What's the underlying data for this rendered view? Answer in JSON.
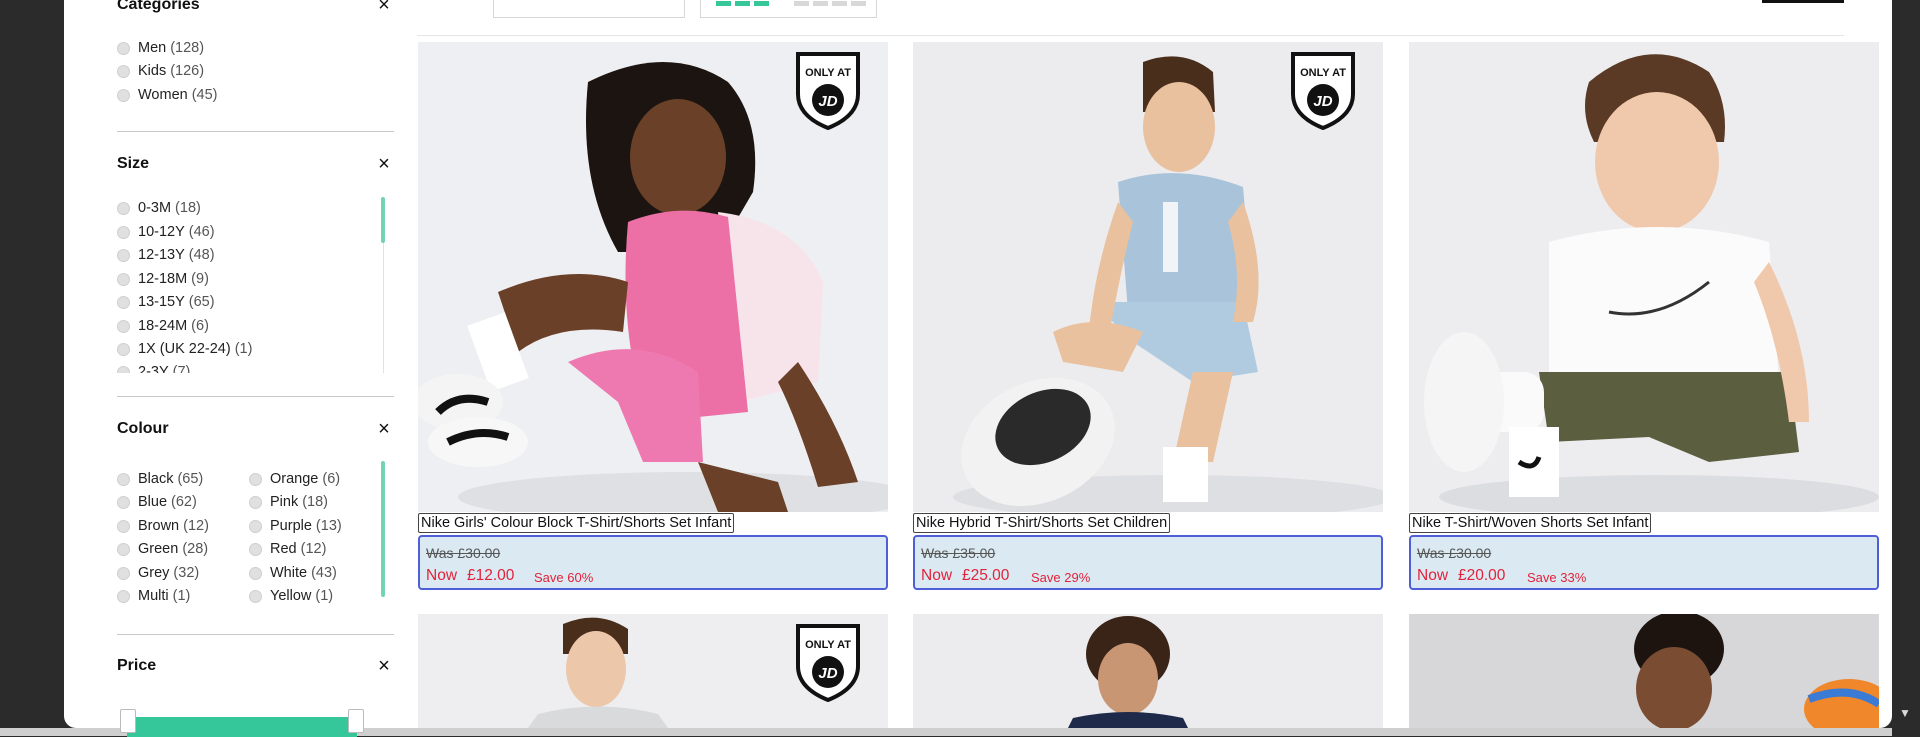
{
  "filters": {
    "categories": {
      "title": "Categories",
      "options": [
        {
          "label": "Men",
          "count": "(128)"
        },
        {
          "label": "Kids",
          "count": "(126)"
        },
        {
          "label": "Women",
          "count": "(45)"
        }
      ]
    },
    "size": {
      "title": "Size",
      "options": [
        {
          "label": "0-3M",
          "count": "(18)"
        },
        {
          "label": "10-12Y",
          "count": "(46)"
        },
        {
          "label": "12-13Y",
          "count": "(48)"
        },
        {
          "label": "12-18M",
          "count": "(9)"
        },
        {
          "label": "13-15Y",
          "count": "(65)"
        },
        {
          "label": "18-24M",
          "count": "(6)"
        },
        {
          "label": "1X (UK 22-24)",
          "count": "(1)"
        },
        {
          "label": "2-3Y",
          "count": "(7)"
        }
      ]
    },
    "colour": {
      "title": "Colour",
      "options": [
        {
          "label": "Black",
          "count": "(65)"
        },
        {
          "label": "Blue",
          "count": "(62)"
        },
        {
          "label": "Brown",
          "count": "(12)"
        },
        {
          "label": "Green",
          "count": "(28)"
        },
        {
          "label": "Grey",
          "count": "(32)"
        },
        {
          "label": "Multi",
          "count": "(1)"
        },
        {
          "label": "Orange",
          "count": "(6)"
        },
        {
          "label": "Pink",
          "count": "(18)"
        },
        {
          "label": "Purple",
          "count": "(13)"
        },
        {
          "label": "Red",
          "count": "(12)"
        },
        {
          "label": "White",
          "count": "(43)"
        },
        {
          "label": "Yellow",
          "count": "(1)"
        }
      ]
    },
    "price": {
      "title": "Price"
    }
  },
  "products": [
    {
      "name": "Nike Girls' Colour Block T-Shirt/Shorts Set Infant",
      "was_label": "Was",
      "was_price": "£30.00",
      "now_label": "Now",
      "now_price": "£12.00",
      "save": "Save 60%",
      "badge": "ONLY AT JD"
    },
    {
      "name": "Nike Hybrid T-Shirt/Shorts Set Children",
      "was_label": "Was",
      "was_price": "£35.00",
      "now_label": "Now",
      "now_price": "£25.00",
      "save": "Save 29%",
      "badge": "ONLY AT JD"
    },
    {
      "name": "Nike T-Shirt/Woven Shorts Set Infant",
      "was_label": "Was",
      "was_price": "£30.00",
      "now_label": "Now",
      "now_price": "£20.00",
      "save": "Save 33%",
      "badge": ""
    }
  ],
  "theme": {
    "accent": "#35c79a",
    "sale_red": "#e2223a",
    "price_box_bg": "#dbeaf2",
    "price_box_border": "#4f5fd8"
  },
  "icons": {
    "close": "close-icon",
    "scroll_down": "scroll-down-arrow-icon"
  }
}
